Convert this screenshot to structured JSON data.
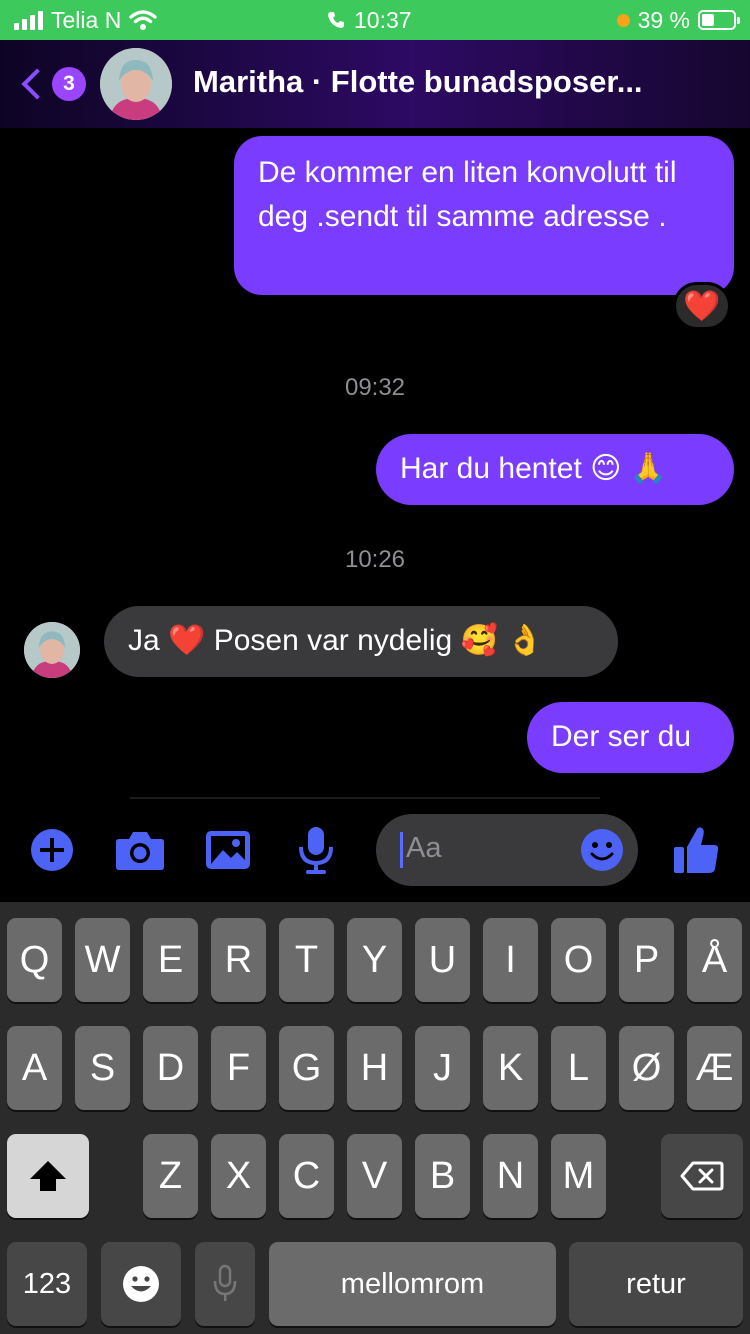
{
  "status_bar": {
    "carrier": "Telia N",
    "time": "10:37",
    "battery": "39 %",
    "battery_level": 0.39
  },
  "header": {
    "back_count": "3",
    "title": "Maritha · Flotte bunadsposer..."
  },
  "messages": [
    {
      "direction": "out",
      "text": "De kommer en liten konvolutt til deg .sendt til samme adresse .",
      "reaction": "❤️"
    },
    {
      "direction": "timestamp",
      "text": "09:32"
    },
    {
      "direction": "out",
      "text": "Har du hentet 😊 🙏"
    },
    {
      "direction": "timestamp",
      "text": "10:26"
    },
    {
      "direction": "in",
      "text": "Ja ❤️ Posen var nydelig 🥰 👌"
    },
    {
      "direction": "out",
      "text": "Der ser du"
    }
  ],
  "composer": {
    "placeholder": "Aa",
    "icons": [
      "plus-icon",
      "camera-icon",
      "image-icon",
      "microphone-icon",
      "smiley-icon",
      "thumbs-up-icon"
    ]
  },
  "keyboard": {
    "row1": [
      "Q",
      "W",
      "E",
      "R",
      "T",
      "Y",
      "U",
      "I",
      "O",
      "P",
      "Å"
    ],
    "row2": [
      "A",
      "S",
      "D",
      "F",
      "G",
      "H",
      "J",
      "K",
      "L",
      "Ø",
      "Æ"
    ],
    "row3": [
      "Z",
      "X",
      "C",
      "V",
      "B",
      "N",
      "M"
    ],
    "numbers": "123",
    "space": "mellomrom",
    "return": "retur"
  },
  "colors": {
    "statusbar": "#3ec95c",
    "accent": "#7a3cff",
    "incoming": "#3a3a3c"
  }
}
